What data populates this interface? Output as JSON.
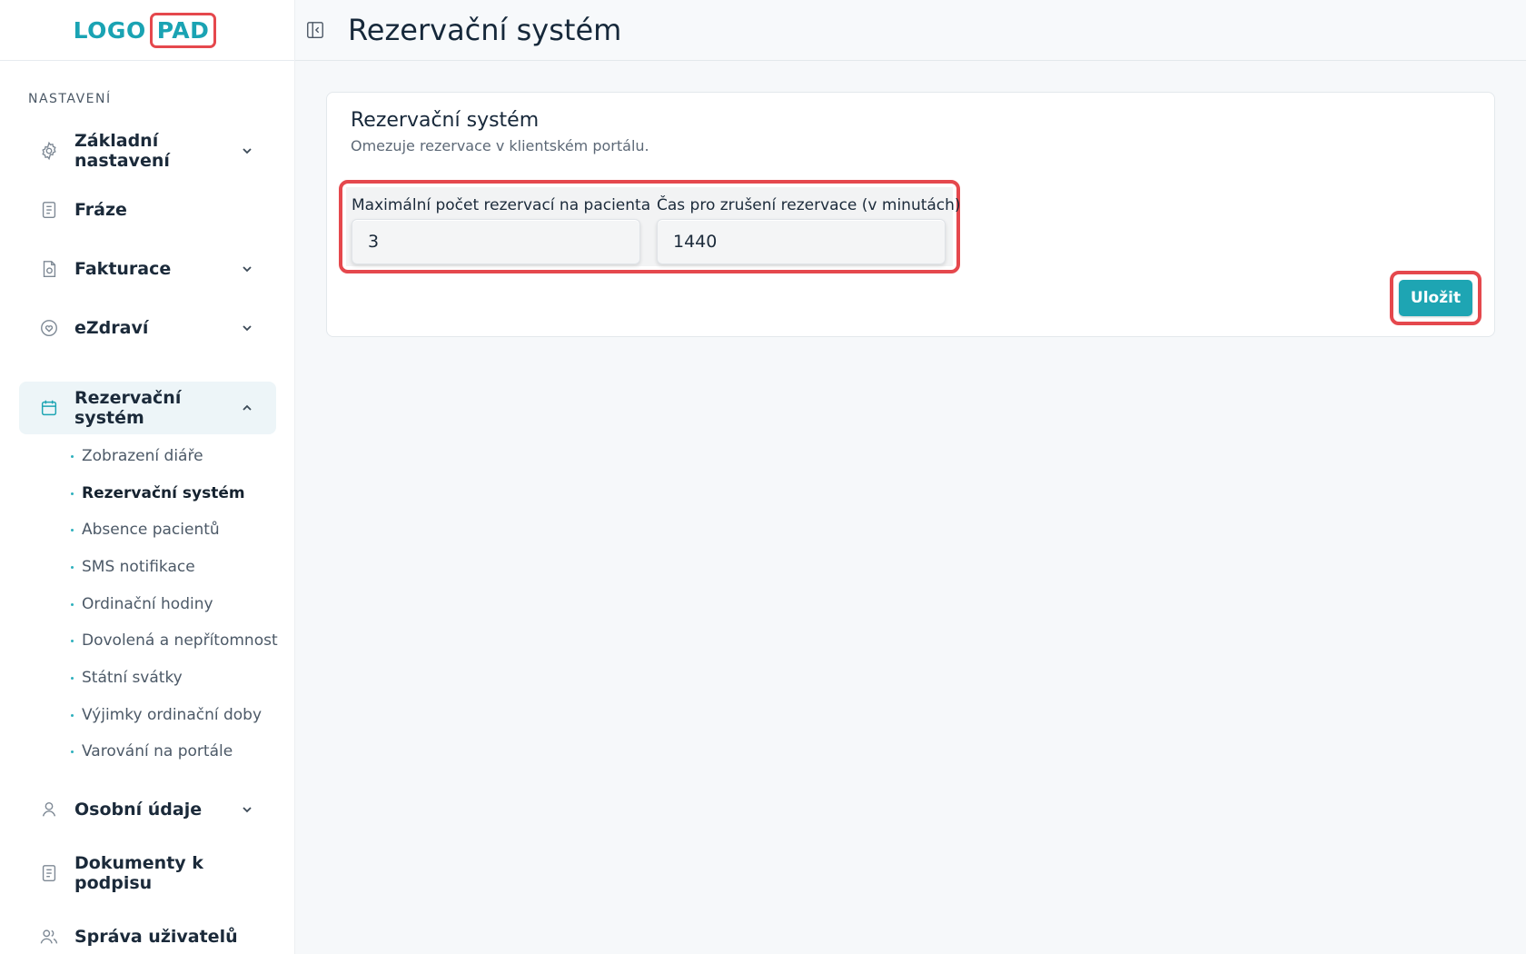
{
  "logo": {
    "part1": "LOGO",
    "part2": "PAD"
  },
  "sidebar": {
    "section_title": "NASTAVENÍ",
    "items": [
      {
        "label": "Základní nastavení",
        "icon": "gear-icon",
        "expandable": true,
        "expanded": false
      },
      {
        "label": "Fráze",
        "icon": "document-icon",
        "expandable": false
      },
      {
        "label": "Fakturace",
        "icon": "invoice-icon",
        "expandable": true,
        "expanded": false
      },
      {
        "label": "eZdraví",
        "icon": "heart-circle-icon",
        "expandable": true,
        "expanded": false
      },
      {
        "label": "Rezervační systém",
        "icon": "calendar-icon",
        "expandable": true,
        "expanded": true,
        "active": true
      },
      {
        "label": "Osobní údaje",
        "icon": "user-icon",
        "expandable": true,
        "expanded": false
      },
      {
        "label": "Dokumenty k podpisu",
        "icon": "document-icon",
        "expandable": false
      },
      {
        "label": "Správa uživatelů",
        "icon": "users-icon",
        "expandable": false
      }
    ],
    "sub_items": [
      {
        "label": "Zobrazení diáře"
      },
      {
        "label": "Rezervační systém",
        "active": true
      },
      {
        "label": "Absence pacientů"
      },
      {
        "label": "SMS notifikace"
      },
      {
        "label": "Ordinační hodiny"
      },
      {
        "label": "Dovolená a nepřítomnost"
      },
      {
        "label": "Státní svátky"
      },
      {
        "label": "Výjimky ordinační doby"
      },
      {
        "label": "Varování na portále"
      }
    ]
  },
  "header": {
    "title": "Rezervační systém",
    "collapse_icon": "sidebar-collapse-icon"
  },
  "card": {
    "title": "Rezervační systém",
    "subtitle": "Omezuje rezervace v klientském portálu.",
    "fields": [
      {
        "label": "Maximální počet rezervací na pacienta",
        "value": "3"
      },
      {
        "label": "Čas pro zrušení rezervace (v minutách)",
        "value": "1440"
      }
    ],
    "save_label": "Uložit"
  },
  "colors": {
    "accent": "#1ea5b3",
    "highlight": "#e5484d",
    "active_bg": "#edf5f8"
  }
}
